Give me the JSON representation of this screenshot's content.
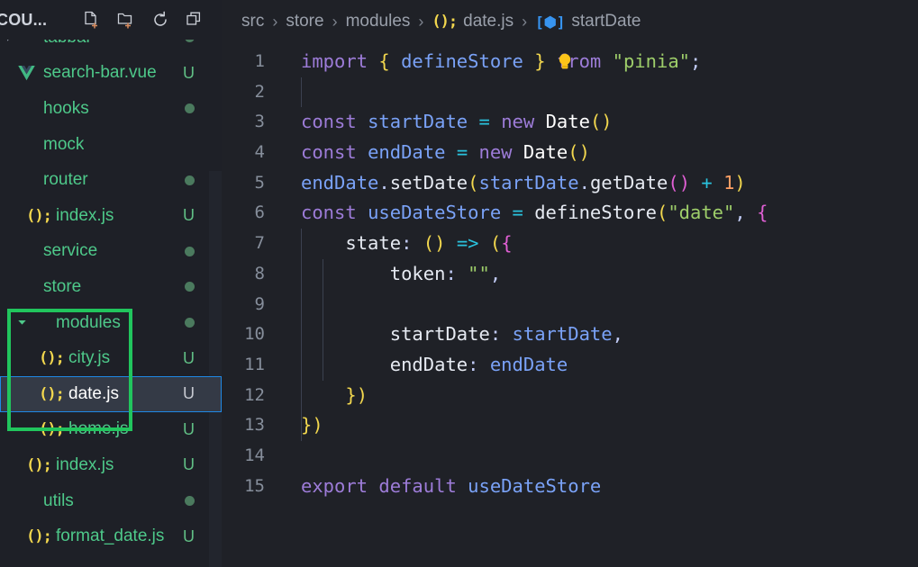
{
  "theme": {
    "sidebar_bg": "#1e2027",
    "editor_bg": "#1f2127",
    "selected_row_bg": "#343a46",
    "selection_border": "#1f88e5",
    "annotation_color": "#21c55d",
    "accent_blue": "#3794f0",
    "js_icon_color": "#f2d74e",
    "folder_green": "#4ec98a"
  },
  "sidebar": {
    "title": "COU...",
    "actions": [
      {
        "name": "new-file-icon",
        "tooltip": "New File"
      },
      {
        "name": "new-folder-icon",
        "tooltip": "New Folder"
      },
      {
        "name": "refresh-icon",
        "tooltip": "Refresh Explorer"
      },
      {
        "name": "collapse-all-icon",
        "tooltip": "Collapse Folders in Explorer"
      }
    ],
    "tree": [
      {
        "label": "tabbar",
        "kind": "folder",
        "icon": "chevron-right-icon",
        "indent": 1,
        "badge": "",
        "dot": true,
        "selected": false
      },
      {
        "label": "search-bar.vue",
        "kind": "file",
        "icon": "vue-icon",
        "indent": 1,
        "badge": "U",
        "dot": false,
        "selected": false
      },
      {
        "label": "hooks",
        "kind": "folder",
        "icon": "",
        "indent": 1,
        "badge": "",
        "dot": true,
        "selected": false
      },
      {
        "label": "mock",
        "kind": "folder",
        "icon": "",
        "indent": 1,
        "badge": "",
        "dot": false,
        "selected": false
      },
      {
        "label": "router",
        "kind": "folder",
        "icon": "",
        "indent": 1,
        "badge": "",
        "dot": true,
        "selected": false
      },
      {
        "label": "index.js",
        "kind": "file",
        "icon": "js-icon",
        "indent": 2,
        "badge": "U",
        "dot": false,
        "selected": false
      },
      {
        "label": "service",
        "kind": "folder",
        "icon": "",
        "indent": 1,
        "badge": "",
        "dot": true,
        "selected": false
      },
      {
        "label": "store",
        "kind": "folder",
        "icon": "",
        "indent": 1,
        "badge": "",
        "dot": true,
        "selected": false
      },
      {
        "label": "modules",
        "kind": "folder",
        "icon": "chevron-down-icon",
        "indent": 2,
        "badge": "",
        "dot": true,
        "selected": false
      },
      {
        "label": "city.js",
        "kind": "file",
        "icon": "js-icon",
        "indent": 3,
        "badge": "U",
        "dot": false,
        "selected": false
      },
      {
        "label": "date.js",
        "kind": "file",
        "icon": "js-icon",
        "indent": 3,
        "badge": "U",
        "dot": false,
        "selected": true
      },
      {
        "label": "home.js",
        "kind": "file",
        "icon": "js-icon",
        "indent": 3,
        "badge": "U",
        "dot": false,
        "selected": false
      },
      {
        "label": "index.js",
        "kind": "file",
        "icon": "js-icon",
        "indent": 2,
        "badge": "U",
        "dot": false,
        "selected": false
      },
      {
        "label": "utils",
        "kind": "folder",
        "icon": "",
        "indent": 1,
        "badge": "",
        "dot": true,
        "selected": false
      },
      {
        "label": "format_date.js",
        "kind": "file",
        "icon": "js-icon",
        "indent": 2,
        "badge": "U",
        "dot": false,
        "selected": false
      }
    ]
  },
  "breadcrumb": {
    "separator": "›",
    "items": [
      {
        "label": "src",
        "icon": ""
      },
      {
        "label": "store",
        "icon": ""
      },
      {
        "label": "modules",
        "icon": ""
      },
      {
        "label": "date.js",
        "icon": "js-icon"
      },
      {
        "label": "startDate",
        "icon": "variable-symbol-icon"
      }
    ]
  },
  "editor": {
    "lightbulb_icon": "quick-fix-lightbulb-icon",
    "highlighted_line": 3,
    "lines": [
      {
        "n": "1",
        "text": "import { defineStore } from \"pinia\";"
      },
      {
        "n": "2",
        "text": ""
      },
      {
        "n": "3",
        "text": "const startDate = new Date()"
      },
      {
        "n": "4",
        "text": "const endDate = new Date()"
      },
      {
        "n": "5",
        "text": "endDate.setDate(startDate.getDate() + 1)"
      },
      {
        "n": "6",
        "text": "const useDateStore = defineStore(\"date\", {"
      },
      {
        "n": "7",
        "text": "    state: () => ({"
      },
      {
        "n": "8",
        "text": "        token: \"\","
      },
      {
        "n": "9",
        "text": ""
      },
      {
        "n": "10",
        "text": "        startDate: startDate,"
      },
      {
        "n": "11",
        "text": "        endDate: endDate"
      },
      {
        "n": "12",
        "text": "    })"
      },
      {
        "n": "13",
        "text": "})"
      },
      {
        "n": "14",
        "text": ""
      },
      {
        "n": "15",
        "text": "export default useDateStore"
      }
    ]
  }
}
